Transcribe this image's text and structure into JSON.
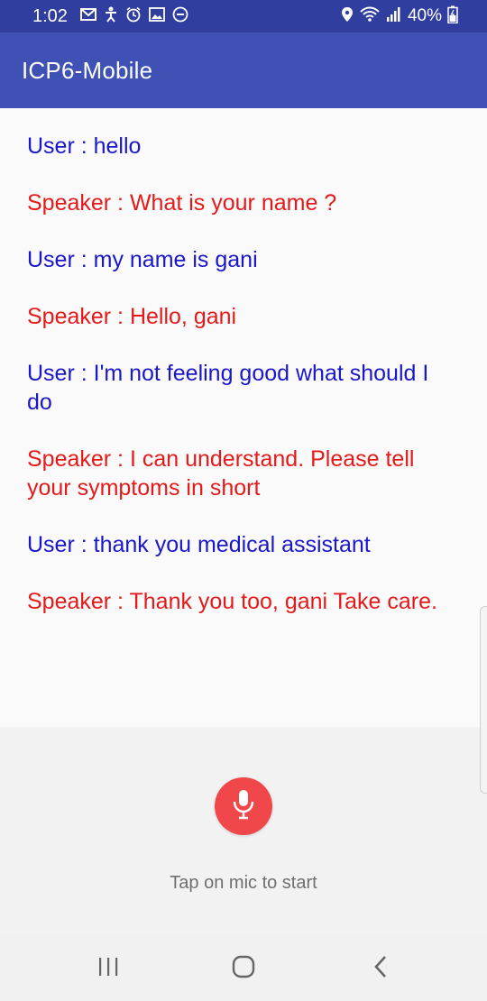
{
  "status_bar": {
    "time": "1:02",
    "battery": "40%",
    "icons_left": [
      "gmail-icon",
      "accessibility-icon",
      "alarm-icon",
      "image-icon",
      "do-not-disturb-icon"
    ],
    "icons_right": [
      "location-icon",
      "wifi-icon",
      "signal-icon",
      "battery-icon"
    ]
  },
  "app_bar": {
    "title": "ICP6-Mobile"
  },
  "messages": [
    {
      "role": "user",
      "text": "User : hello"
    },
    {
      "role": "speaker",
      "text": "Speaker : What is your name ?"
    },
    {
      "role": "user",
      "text": "User : my name is gani"
    },
    {
      "role": "speaker",
      "text": "Speaker : Hello, gani"
    },
    {
      "role": "user",
      "text": "User : I'm not feeling good what should I do"
    },
    {
      "role": "speaker",
      "text": "Speaker : I can understand. Please tell your symptoms in short"
    },
    {
      "role": "user",
      "text": "User : thank you medical assistant"
    },
    {
      "role": "speaker",
      "text": "Speaker : Thank you too, gani Take care."
    }
  ],
  "input": {
    "mic_icon": "microphone-icon",
    "hint": "Tap on mic to start"
  },
  "colors": {
    "app_bar": "#3f51b5",
    "status_bar": "#303f9f",
    "user_text": "#1a17c8",
    "speaker_text": "#e41a1a",
    "mic_button": "#f0474a"
  },
  "nav_bar": {
    "recents_icon": "recents-icon",
    "home_icon": "home-icon",
    "back_icon": "back-icon"
  }
}
